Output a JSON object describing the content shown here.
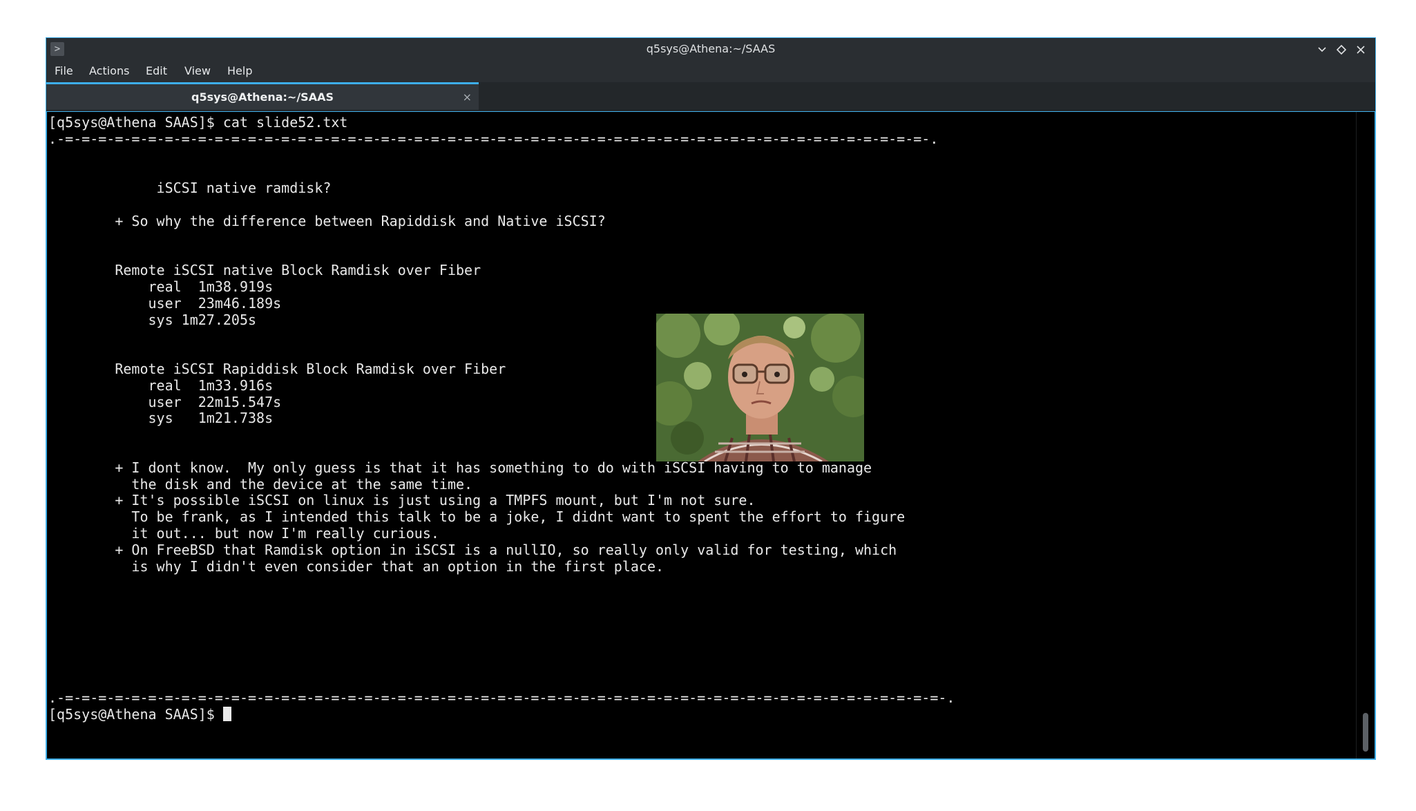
{
  "window": {
    "title": "q5sys@Athena:~/SAAS",
    "app_icon": ">"
  },
  "menu": [
    "File",
    "Actions",
    "Edit",
    "View",
    "Help"
  ],
  "tab": {
    "label": "q5sys@Athena:~/SAAS",
    "close": "×"
  },
  "terminal": {
    "lines": [
      "[q5sys@Athena SAAS]$ cat slide52.txt",
      ".-=-=-=-=-=-=-=-=-=-=-=-=-=-=-=-=-=-=-=-=-=-=-=-=-=-=-=-=-=-=-=-=-=-=-=-=-=-=-=-=-=-=-=-=-=-=-=-=-=-=-=-=-.",
      "",
      "",
      "             iSCSI native ramdisk?",
      "",
      "        + So why the difference between Rapiddisk and Native iSCSI?",
      "",
      "",
      "        Remote iSCSI native Block Ramdisk over Fiber",
      "            real  1m38.919s",
      "            user  23m46.189s",
      "            sys 1m27.205s",
      "",
      "",
      "        Remote iSCSI Rapiddisk Block Ramdisk over Fiber",
      "            real  1m33.916s",
      "            user  22m15.547s",
      "            sys   1m21.738s",
      "",
      "",
      "        + I dont know.  My only guess is that it has something to do with iSCSI having to to manage",
      "          the disk and the device at the same time.",
      "        + It's possible iSCSI on linux is just using a TMPFS mount, but I'm not sure.",
      "          To be frank, as I intended this talk to be a joke, I didnt want to spent the effort to figure",
      "          it out... but now I'm really curious.",
      "        + On FreeBSD that Ramdisk option in iSCSI is a nullIO, so really only valid for testing, which",
      "          is why I didn't even consider that an option in the first place.",
      "",
      "",
      "",
      "",
      "",
      "",
      "",
      ".-=-=-=-=-=-=-=-=-=-=-=-=-=-=-=-=-=-=-=-=-=-=-=-=-=-=-=-=-=-=-=-=-=-=-=-=-=-=-=-=-=-=-=-=-=-=-=-=-=-=-=-=-=-."
    ],
    "prompt": "[q5sys@Athena SAAS]$ "
  },
  "colors": {
    "accent": "#3daee9",
    "terminal_bg": "#000000",
    "terminal_fg": "#e8e8e8",
    "chrome_bg": "#2a2e32"
  },
  "icons": [
    "terminal-app-icon",
    "minimize-icon",
    "maximize-icon",
    "close-icon",
    "tab-close-icon"
  ]
}
